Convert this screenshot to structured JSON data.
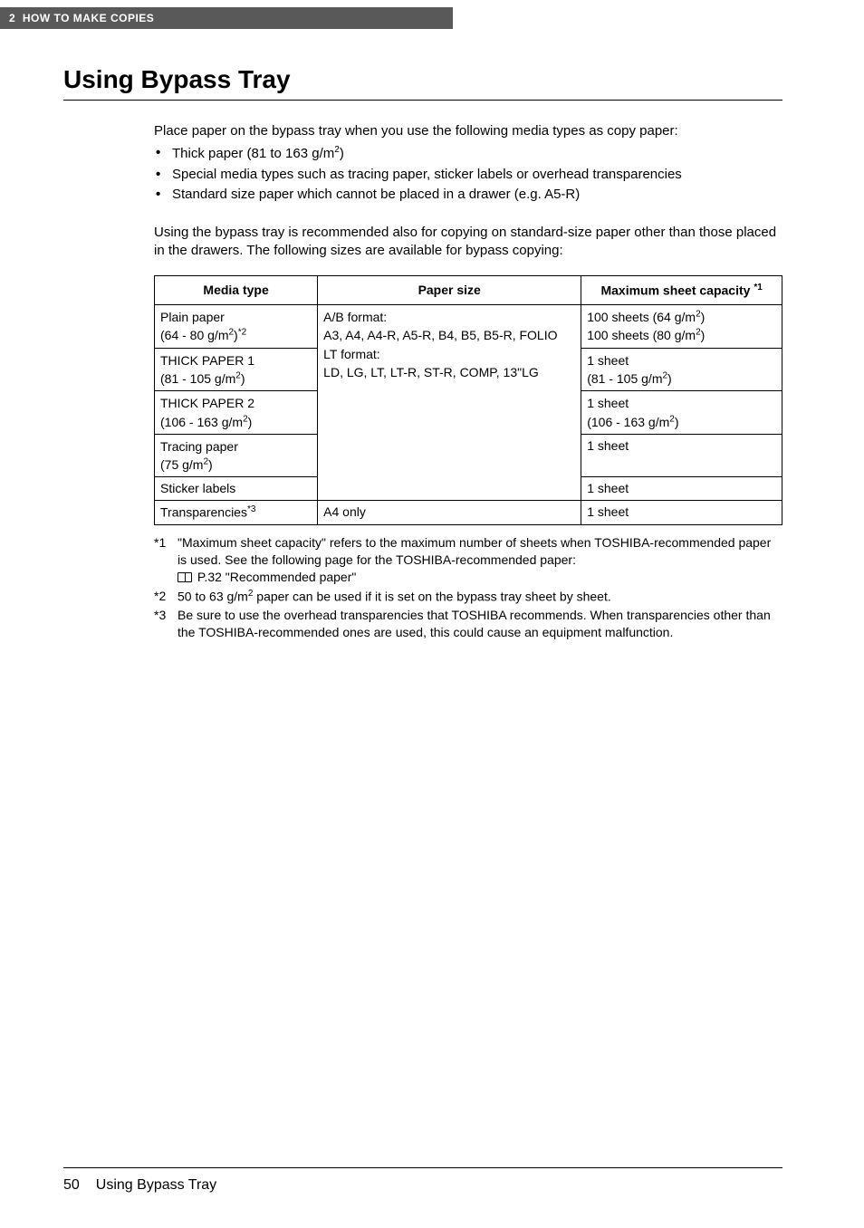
{
  "header": {
    "chapter_num": "2",
    "chapter_title": "HOW TO MAKE COPIES"
  },
  "heading": "Using Bypass Tray",
  "intro_line": "Place paper on the bypass tray when you use the following media types as copy paper:",
  "bullets": [
    {
      "pre": "Thick paper (81 to 163 g/m",
      "sup": "2",
      "post": ")"
    },
    {
      "pre": "Special media types such as tracing paper, sticker labels or overhead transparencies",
      "sup": "",
      "post": ""
    },
    {
      "pre": "Standard size paper which cannot be placed in a drawer (e.g. A5-R)",
      "sup": "",
      "post": ""
    }
  ],
  "para2": "Using the bypass tray is recommended also for copying on standard-size paper other than those placed in the drawers. The following sizes are available for bypass copying:",
  "table": {
    "headers": {
      "media": "Media type",
      "size": "Paper size",
      "capacity_pre": "Maximum sheet capacity ",
      "capacity_sup": "*1"
    },
    "size_cell": {
      "l1": "A/B format:",
      "l2": "A3, A4, A4-R, A5-R, B4, B5, B5-R, FOLIO",
      "l3": "LT format:",
      "l4": "LD, LG, LT, LT-R, ST-R, COMP, 13\"LG"
    },
    "rows": [
      {
        "media_l1": "Plain paper",
        "media_l2_pre": "(64 - 80 g/m",
        "media_l2_sup1": "2",
        "media_l2_mid": ")",
        "media_l2_sup2": "*2",
        "media_l2_post": "",
        "cap_l1_pre": "100 sheets (64 g/m",
        "cap_l1_sup": "2",
        "cap_l1_post": ")",
        "cap_l2_pre": "100 sheets (80 g/m",
        "cap_l2_sup": "2",
        "cap_l2_post": ")"
      },
      {
        "media_l1": "THICK PAPER 1",
        "media_l2_pre": "(81 - 105 g/m",
        "media_l2_sup1": "2",
        "media_l2_mid": ")",
        "media_l2_sup2": "",
        "media_l2_post": "",
        "cap_l1_pre": "1 sheet",
        "cap_l1_sup": "",
        "cap_l1_post": "",
        "cap_l2_pre": "(81 - 105 g/m",
        "cap_l2_sup": "2",
        "cap_l2_post": ")"
      },
      {
        "media_l1": "THICK PAPER 2",
        "media_l2_pre": "(106 - 163 g/m",
        "media_l2_sup1": "2",
        "media_l2_mid": ")",
        "media_l2_sup2": "",
        "media_l2_post": "",
        "cap_l1_pre": "1 sheet",
        "cap_l1_sup": "",
        "cap_l1_post": "",
        "cap_l2_pre": "(106 - 163 g/m",
        "cap_l2_sup": "2",
        "cap_l2_post": ")"
      },
      {
        "media_l1": "Tracing paper",
        "media_l2_pre": "(75 g/m",
        "media_l2_sup1": "2",
        "media_l2_mid": ")",
        "media_l2_sup2": "",
        "media_l2_post": "",
        "cap_l1_pre": "1 sheet",
        "cap_l1_sup": "",
        "cap_l1_post": "",
        "cap_l2_pre": "",
        "cap_l2_sup": "",
        "cap_l2_post": ""
      }
    ],
    "row_sticker": {
      "media": "Sticker labels",
      "cap": "1 sheet"
    },
    "row_trans": {
      "media_pre": "Transparencies",
      "media_sup": "*3",
      "size": "A4 only",
      "cap": "1 sheet"
    }
  },
  "footnotes": {
    "f1": {
      "num": "*1",
      "l1": "\"Maximum sheet capacity\" refers to the maximum number of sheets when TOSHIBA-recommended paper is used. See the following page for the TOSHIBA-recommended paper:",
      "ref": " P.32 \"Recommended paper\""
    },
    "f2": {
      "num": "*2",
      "pre": "50 to 63 g/m",
      "sup": "2",
      "post": " paper can be used if it is set on the bypass tray sheet by sheet."
    },
    "f3": {
      "num": "*3",
      "text": "Be sure to use the overhead transparencies that TOSHIBA recommends. When transparencies other than the TOSHIBA-recommended ones are used, this could cause an equipment malfunction."
    }
  },
  "footer": {
    "page": "50",
    "title": "Using Bypass Tray"
  }
}
